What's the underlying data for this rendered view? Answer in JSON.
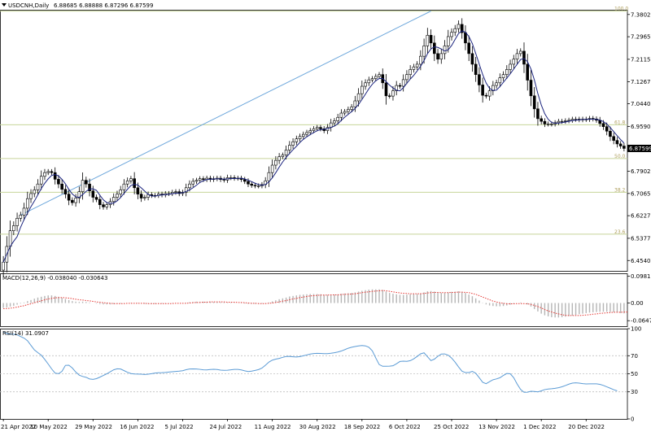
{
  "header": {
    "symbol_label": "USDCNH,Daily",
    "ohlc_text": "6.88685 6.88888 6.87296 6.87599"
  },
  "colors": {
    "background": "#ffffff",
    "candle_up": "#ffffff",
    "candle_down": "#000000",
    "candle_outline": "#000000",
    "moving_average": "#1a237e",
    "fib_levels": "#c6d49a",
    "trendline": "#6fa8dc",
    "macd_histogram": "#b5b5b5",
    "macd_signal": "#e53935",
    "rsi_line": "#5b9bd5",
    "rsi_levels": "#c0c0c0",
    "price_tag_bg": "#000000",
    "price_tag_text": "#ffffff"
  },
  "chart_data": [
    {
      "type": "candlestick",
      "name": "price",
      "title": "USDCNH,Daily",
      "ohlc_last": {
        "open": 6.88685,
        "high": 6.88888,
        "low": 6.87296,
        "close": 6.87599
      },
      "current_price_label": "6.87599",
      "y_ticks": [
        "7.38025",
        "7.29650",
        "7.21155",
        "7.12670",
        "7.04400",
        "6.95900",
        "6.79025",
        "6.70650",
        "6.62275",
        "6.53775",
        "6.45400"
      ],
      "y_tick_values": [
        7.38025,
        7.2965,
        7.21155,
        7.1267,
        7.044,
        6.959,
        6.79025,
        6.7065,
        6.62275,
        6.53775,
        6.454
      ],
      "ylim": [
        6.415,
        7.398
      ],
      "x_tick_labels": [
        "21 Apr 2022",
        "10 May 2022",
        "29 May 2022",
        "16 Jun 2022",
        "5 Jul 2022",
        "24 Jul 2022",
        "11 Aug 2022",
        "30 Aug 2022",
        "18 Sep 2022",
        "6 Oct 2022",
        "25 Oct 2022",
        "13 Nov 2022",
        "1 Dec 2022",
        "20 Dec 2022"
      ],
      "x_tick_bar_index": [
        0,
        13,
        26,
        39,
        52,
        65,
        78,
        91,
        104,
        117,
        130,
        143,
        156,
        169
      ],
      "fibonacci": [
        {
          "label": "100.0",
          "value": 7.393
        },
        {
          "label": "61.8",
          "value": 6.965
        },
        {
          "label": "50.0",
          "value": 6.838
        },
        {
          "label": "38.2",
          "value": 6.711
        },
        {
          "label": "23.6",
          "value": 6.553
        }
      ],
      "trendline": {
        "from": {
          "bar": 5,
          "value": 6.625
        },
        "to": {
          "bar": 124,
          "value": 7.393
        }
      },
      "moving_average_period_note": "",
      "closes": [
        6.448,
        6.507,
        6.566,
        6.585,
        6.613,
        6.625,
        6.651,
        6.687,
        6.706,
        6.72,
        6.742,
        6.771,
        6.785,
        6.789,
        6.785,
        6.76,
        6.742,
        6.722,
        6.704,
        6.681,
        6.672,
        6.689,
        6.713,
        6.756,
        6.742,
        6.716,
        6.692,
        6.684,
        6.664,
        6.656,
        6.664,
        6.676,
        6.692,
        6.704,
        6.72,
        6.742,
        6.754,
        6.762,
        6.728,
        6.704,
        6.689,
        6.692,
        6.702,
        6.699,
        6.699,
        6.704,
        6.701,
        6.706,
        6.706,
        6.711,
        6.713,
        6.706,
        6.711,
        6.728,
        6.742,
        6.752,
        6.756,
        6.762,
        6.759,
        6.764,
        6.759,
        6.762,
        6.764,
        6.759,
        6.757,
        6.766,
        6.766,
        6.764,
        6.764,
        6.759,
        6.752,
        6.742,
        6.737,
        6.735,
        6.735,
        6.74,
        6.754,
        6.785,
        6.813,
        6.831,
        6.845,
        6.851,
        6.87,
        6.888,
        6.901,
        6.912,
        6.921,
        6.929,
        6.936,
        6.943,
        6.95,
        6.955,
        6.95,
        6.943,
        6.955,
        6.972,
        6.98,
        6.993,
        7.009,
        7.015,
        7.023,
        7.032,
        7.055,
        7.082,
        7.11,
        7.123,
        7.134,
        7.139,
        7.147,
        7.154,
        7.123,
        7.074,
        7.073,
        7.093,
        7.113,
        7.11,
        7.135,
        7.154,
        7.173,
        7.183,
        7.193,
        7.223,
        7.262,
        7.302,
        7.273,
        7.233,
        7.212,
        7.233,
        7.262,
        7.297,
        7.313,
        7.327,
        7.343,
        7.312,
        7.273,
        7.233,
        7.193,
        7.154,
        7.115,
        7.076,
        7.073,
        7.093,
        7.113,
        7.123,
        7.142,
        7.154,
        7.173,
        7.193,
        7.212,
        7.233,
        7.242,
        7.193,
        7.133,
        7.074,
        7.025,
        6.988,
        6.978,
        6.968,
        6.968,
        6.968,
        6.973,
        6.978,
        6.978,
        6.98,
        6.982,
        6.986,
        6.986,
        6.984,
        6.986,
        6.985,
        6.989,
        6.987,
        6.982,
        6.97,
        6.958,
        6.941,
        6.921,
        6.906,
        6.893,
        6.885,
        6.876
      ]
    },
    {
      "type": "bar",
      "name": "macd",
      "label": "MACD(12,26,9) -0.038040 -0.030643",
      "main_value": -0.03804,
      "signal_value": -0.030643,
      "y_ticks": [
        "0.098171",
        "0.00",
        "-0.06479"
      ],
      "y_tick_values": [
        0.098171,
        0.0,
        -0.06479
      ],
      "ylim": [
        -0.085,
        0.109
      ],
      "values": [
        -0.018,
        -0.016,
        -0.013,
        -0.01,
        -0.006,
        -0.002,
        0.002,
        0.007,
        0.011,
        0.016,
        0.02,
        0.023,
        0.026,
        0.028,
        0.028,
        0.026,
        0.023,
        0.019,
        0.015,
        0.011,
        0.007,
        0.005,
        0.004,
        0.005,
        0.004,
        0.002,
        0.0,
        -0.002,
        -0.004,
        -0.005,
        -0.005,
        -0.005,
        -0.004,
        -0.003,
        -0.002,
        -0.001,
        0.0,
        0.001,
        0.0,
        -0.001,
        -0.002,
        -0.003,
        -0.003,
        -0.003,
        -0.003,
        -0.002,
        -0.002,
        -0.002,
        -0.001,
        -0.001,
        -0.0,
        -0.0,
        0.0,
        0.001,
        0.003,
        0.004,
        0.005,
        0.005,
        0.005,
        0.005,
        0.005,
        0.004,
        0.004,
        0.003,
        0.003,
        0.002,
        0.002,
        0.001,
        0.0,
        -0.001,
        -0.002,
        -0.003,
        -0.003,
        -0.003,
        -0.003,
        -0.002,
        -0.001,
        0.002,
        0.006,
        0.01,
        0.014,
        0.017,
        0.02,
        0.024,
        0.026,
        0.028,
        0.03,
        0.031,
        0.032,
        0.033,
        0.033,
        0.033,
        0.032,
        0.03,
        0.03,
        0.031,
        0.031,
        0.032,
        0.034,
        0.035,
        0.036,
        0.037,
        0.039,
        0.042,
        0.045,
        0.047,
        0.049,
        0.05,
        0.05,
        0.05,
        0.048,
        0.042,
        0.037,
        0.034,
        0.032,
        0.03,
        0.03,
        0.031,
        0.032,
        0.033,
        0.033,
        0.035,
        0.039,
        0.043,
        0.044,
        0.042,
        0.039,
        0.037,
        0.037,
        0.039,
        0.041,
        0.042,
        0.043,
        0.041,
        0.037,
        0.031,
        0.025,
        0.017,
        0.009,
        0.001,
        -0.005,
        -0.009,
        -0.011,
        -0.012,
        -0.012,
        -0.011,
        -0.009,
        -0.006,
        -0.003,
        0.0,
        0.002,
        0.0,
        -0.005,
        -0.013,
        -0.022,
        -0.031,
        -0.039,
        -0.045,
        -0.049,
        -0.052,
        -0.053,
        -0.053,
        -0.052,
        -0.05,
        -0.048,
        -0.046,
        -0.044,
        -0.041,
        -0.039,
        -0.037,
        -0.035,
        -0.034,
        -0.033,
        -0.032,
        -0.032,
        -0.032,
        -0.033,
        -0.034,
        -0.035,
        -0.037,
        -0.038
      ],
      "signal": [
        -0.021,
        -0.02,
        -0.019,
        -0.017,
        -0.015,
        -0.012,
        -0.01,
        -0.006,
        -0.003,
        0.001,
        0.005,
        0.008,
        0.012,
        0.015,
        0.017,
        0.019,
        0.02,
        0.02,
        0.019,
        0.018,
        0.016,
        0.014,
        0.012,
        0.011,
        0.009,
        0.008,
        0.006,
        0.004,
        0.003,
        0.001,
        0.0,
        -0.001,
        -0.002,
        -0.002,
        -0.002,
        -0.002,
        -0.001,
        -0.001,
        -0.001,
        -0.001,
        -0.001,
        -0.001,
        -0.002,
        -0.002,
        -0.002,
        -0.002,
        -0.002,
        -0.002,
        -0.002,
        -0.002,
        -0.001,
        -0.001,
        -0.001,
        -0.001,
        0.0,
        0.001,
        0.002,
        0.002,
        0.003,
        0.003,
        0.004,
        0.004,
        0.004,
        0.004,
        0.004,
        0.003,
        0.003,
        0.003,
        0.002,
        0.002,
        0.001,
        0.0,
        -0.001,
        -0.001,
        -0.002,
        -0.002,
        -0.002,
        -0.001,
        0.0,
        0.002,
        0.004,
        0.007,
        0.009,
        0.012,
        0.015,
        0.017,
        0.02,
        0.022,
        0.024,
        0.026,
        0.027,
        0.028,
        0.029,
        0.029,
        0.029,
        0.03,
        0.03,
        0.03,
        0.031,
        0.032,
        0.032,
        0.033,
        0.034,
        0.036,
        0.038,
        0.04,
        0.041,
        0.043,
        0.044,
        0.045,
        0.046,
        0.045,
        0.043,
        0.041,
        0.039,
        0.037,
        0.036,
        0.035,
        0.034,
        0.034,
        0.034,
        0.034,
        0.035,
        0.037,
        0.038,
        0.039,
        0.039,
        0.038,
        0.038,
        0.038,
        0.039,
        0.039,
        0.04,
        0.04,
        0.039,
        0.038,
        0.035,
        0.032,
        0.027,
        0.022,
        0.017,
        0.012,
        0.007,
        0.004,
        0.001,
        -0.001,
        -0.003,
        -0.003,
        -0.003,
        -0.002,
        -0.002,
        -0.002,
        -0.003,
        -0.005,
        -0.009,
        -0.013,
        -0.018,
        -0.024,
        -0.029,
        -0.033,
        -0.037,
        -0.04,
        -0.043,
        -0.045,
        -0.046,
        -0.046,
        -0.046,
        -0.046,
        -0.045,
        -0.044,
        -0.043,
        -0.041,
        -0.04,
        -0.038,
        -0.037,
        -0.036,
        -0.035,
        -0.034,
        -0.034,
        -0.034,
        -0.033,
        -0.033
      ]
    },
    {
      "type": "line",
      "name": "rsi",
      "label": "RSI(14) 31.0907",
      "y_ticks": [
        "100",
        "70",
        "50",
        "30",
        "0"
      ],
      "y_tick_values": [
        100,
        70,
        50,
        30,
        0
      ],
      "levels": [
        70,
        50,
        30
      ],
      "ylim": [
        0,
        100
      ],
      "values": [
        96.0,
        94.7,
        93.9,
        93.8,
        93.1,
        91.3,
        89.5,
        86.6,
        81.5,
        76.4,
        73.4,
        70.6,
        65.9,
        60.8,
        55.4,
        50.7,
        50.1,
        52.7,
        59.3,
        59.5,
        56.4,
        51.9,
        48.5,
        47.0,
        46.1,
        44.3,
        43.8,
        44.6,
        46.3,
        48.1,
        50.0,
        52.2,
        54.4,
        55.5,
        55.3,
        53.5,
        51.6,
        50.2,
        49.8,
        49.7,
        49.5,
        49.2,
        49.5,
        50.1,
        50.8,
        51.1,
        51.2,
        51.5,
        51.9,
        52.3,
        52.6,
        52.9,
        53.4,
        54.5,
        55.3,
        55.4,
        55.3,
        54.9,
        54.4,
        54.3,
        54.7,
        55.0,
        54.7,
        54.1,
        53.8,
        53.9,
        54.4,
        54.8,
        54.8,
        54.3,
        53.3,
        52.5,
        52.9,
        53.7,
        54.6,
        56.3,
        59.5,
        62.9,
        65.1,
        66.2,
        67.0,
        68.2,
        69.1,
        69.2,
        68.8,
        68.6,
        69.0,
        69.9,
        70.9,
        71.8,
        72.4,
        72.6,
        72.5,
        72.3,
        72.3,
        72.7,
        73.3,
        74.1,
        75.2,
        76.7,
        78.3,
        79.4,
        80.2,
        80.9,
        81.3,
        80.9,
        79.4,
        75.4,
        67.5,
        60.2,
        58.3,
        58.3,
        58.4,
        58.9,
        61.1,
        63.6,
        64.0,
        63.7,
        64.5,
        66.5,
        69.2,
        72.1,
        73.2,
        68.9,
        64.6,
        66.2,
        69.4,
        71.9,
        72.0,
        70.6,
        67.4,
        62.9,
        57.6,
        52.9,
        51.3,
        51.4,
        52.7,
        50.5,
        45.7,
        40.6,
        39.0,
        41.3,
        43.4,
        44.3,
        45.6,
        48.1,
        50.3,
        50.0,
        45.7,
        38.6,
        32.6,
        29.5,
        29.6,
        30.6,
        30.4,
        30.0,
        31.1,
        32.5,
        33.1,
        33.4,
        33.9,
        34.6,
        35.6,
        37.0,
        38.5,
        39.6,
        40.0,
        39.6,
        39.1,
        38.7,
        38.8,
        38.9,
        38.9,
        38.3,
        37.1,
        35.5,
        34.0,
        32.4,
        31.1
      ]
    }
  ]
}
